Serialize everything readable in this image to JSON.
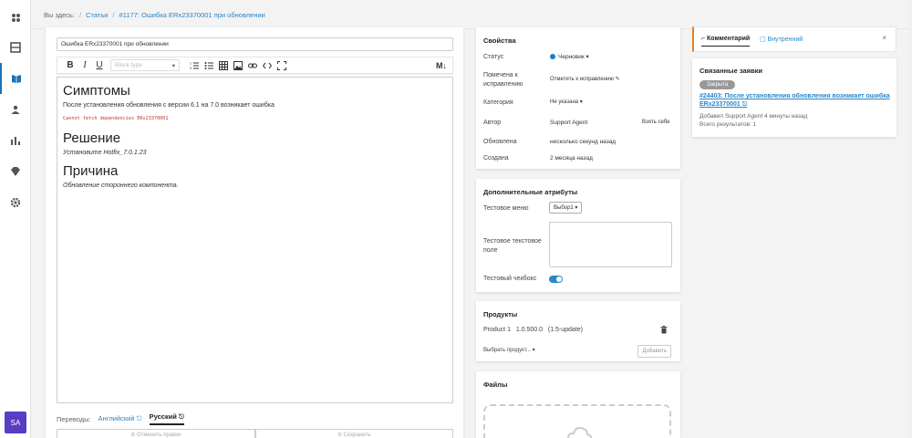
{
  "breadcrumb": {
    "prefix": "Вы здесь:",
    "articles": "Статьи",
    "current": "#1177: Ошибка ERx23370001 при обновлении"
  },
  "nav": {
    "avatar": "SA"
  },
  "editor": {
    "title_value": "Ошибка ERx23370001 при обновлении",
    "block_type_placeholder": "Block type",
    "markdown_label": "M↓",
    "content": {
      "h_symptoms": "Симптомы",
      "p_symptoms": "После установления обновления с версии 6.1 на 7.0 возникает ошибка",
      "code": "Cannot fetch dependencies ERx23370001",
      "h_solution": "Решение",
      "p_solution": "Установите Hotfix_7.0.1.23",
      "h_cause": "Причина",
      "p_cause": "Обновление стороннего компонента."
    },
    "translations": {
      "label": "Переводы:",
      "english": "Английский ⎋",
      "russian": "Русский ⎋"
    },
    "buttons": {
      "cancel": "⊘ Отменить правки",
      "save": "⊘ Сохранить"
    }
  },
  "properties": {
    "title": "Свойства",
    "status_label": "Статус",
    "status_value": "Черновик ▾",
    "marked_label": "Помечена к исправлению",
    "marked_value": "Отметить к исправлению ✎",
    "category_label": "Категория",
    "category_value": "Не указана ▾",
    "author_label": "Автор",
    "author_value": "Support Agent",
    "take_self": "Взять себе",
    "updated_label": "Обновлена",
    "updated_value": "несколько секунд назад",
    "created_label": "Создана",
    "created_value": "2 месяца назад"
  },
  "extra": {
    "title": "Дополнительные атрибуты",
    "menu_label": "Тестовое меню",
    "menu_value": "Выбор1 ▾",
    "text_label": "Тестовое текстовое поле",
    "checkbox_label": "Тестовый чекбокс"
  },
  "products": {
    "title": "Продукты",
    "item_name": "Product 1",
    "item_version": "1.0.500.0",
    "item_note": "(1.5-update)",
    "select_label": "Выбрать продукт... ▾",
    "add_button": "Добавить"
  },
  "files": {
    "title": "Файлы"
  },
  "right": {
    "tab_comment": "⌐ Комментарий",
    "tab_internal": "▢ Внутренний",
    "close": "×",
    "related_title": "Связанные заявки",
    "badge": "Закрыта",
    "link": "#24403: После установления обновления возникает ошибка ERx23370001 ⎋",
    "added": "Добавил Support Agent 4 минуты назад",
    "total": "Всего результатов: 1"
  },
  "colors": {
    "accent": "#2a86c9",
    "avatar": "#5b3cc4",
    "tab_border": "#e67e22"
  }
}
